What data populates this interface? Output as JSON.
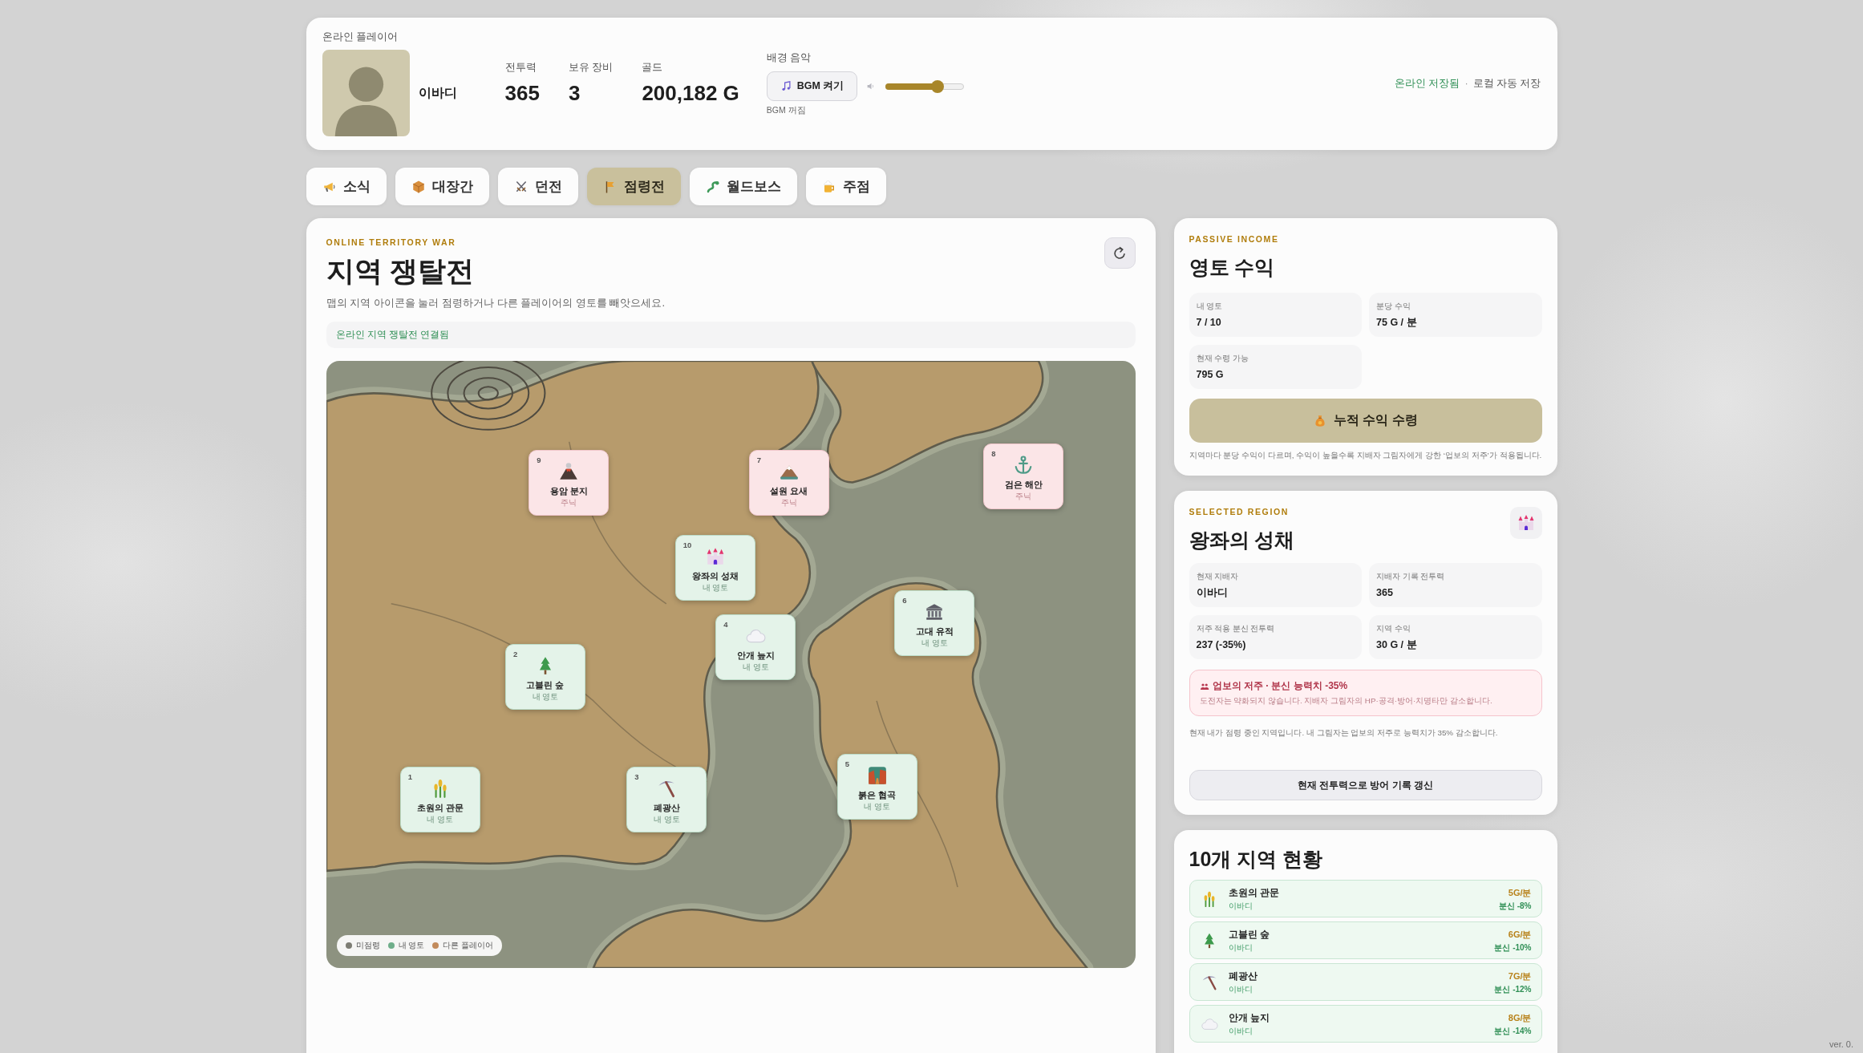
{
  "header": {
    "caption": "온라인 플레이어",
    "player": {
      "name": "이바디"
    },
    "stats": [
      {
        "label": "전투력",
        "value": "365"
      },
      {
        "label": "보유 장비",
        "value": "3"
      },
      {
        "label": "골드",
        "value": "200,182 G"
      }
    ],
    "bgm": {
      "label": "배경 음악",
      "button": "BGM 켜기",
      "status": "BGM 꺼짐",
      "volume": {
        "level": 0.66
      }
    },
    "save_status": {
      "online": "온라인 저장됨",
      "separator": "·",
      "local": "로컬 자동 저장"
    }
  },
  "tabs": [
    {
      "label": "소식",
      "selected": false
    },
    {
      "label": "대장간",
      "selected": false
    },
    {
      "label": "던전",
      "selected": false
    },
    {
      "label": "점령전",
      "selected": true
    },
    {
      "label": "월드보스",
      "selected": false
    },
    {
      "label": "주점",
      "selected": false
    }
  ],
  "territory_war": {
    "eyebrow": "ONLINE TERRITORY WAR",
    "title": "지역 쟁탈전",
    "description": "맵의 지역 아이콘을 눌러 점령하거나 다른 플레이어의 영토를 빼앗으세요.",
    "connection": "온라인 지역 쟁탈전 연결됨",
    "map": {
      "regions": [
        {
          "number": "1",
          "name": "초원의 관문",
          "owner": "내 영토",
          "mine": true
        },
        {
          "number": "2",
          "name": "고블린 숲",
          "owner": "내 영토",
          "mine": true
        },
        {
          "number": "3",
          "name": "폐광산",
          "owner": "내 영토",
          "mine": true
        },
        {
          "number": "4",
          "name": "안개 늪지",
          "owner": "내 영토",
          "mine": true
        },
        {
          "number": "5",
          "name": "붉은 협곡",
          "owner": "내 영토",
          "mine": true
        },
        {
          "number": "6",
          "name": "고대 유적",
          "owner": "내 영토",
          "mine": true
        },
        {
          "number": "7",
          "name": "설원 요새",
          "owner": "주닉",
          "mine": false
        },
        {
          "number": "8",
          "name": "검은 해안",
          "owner": "주닉",
          "mine": false
        },
        {
          "number": "9",
          "name": "용암 분지",
          "owner": "주닉",
          "mine": false
        },
        {
          "number": "10",
          "name": "왕좌의 성채",
          "owner": "내 영토",
          "mine": true
        }
      ],
      "legend": [
        {
          "label": "미점령",
          "color": "#7d7d74"
        },
        {
          "label": "내 영토",
          "color": "#6fae8a"
        },
        {
          "label": "다른 플레이어",
          "color": "#c28b5c"
        }
      ]
    }
  },
  "income": {
    "eyebrow": "PASSIVE INCOME",
    "title": "영토 수익",
    "stats": [
      {
        "label": "내 영토",
        "value": "7 / 10"
      },
      {
        "label": "분당 수익",
        "value": "75 G / 분"
      },
      {
        "label": "현재 수령 가능",
        "value": "795 G"
      }
    ],
    "claim_button": "누적 수익 수령",
    "note": "지역마다 분당 수익이 다르며, 수익이 높을수록 지배자 그림자에게 강한 ‘업보의 저주’가 적용됩니다."
  },
  "selected_region": {
    "eyebrow": "SELECTED REGION",
    "title": "왕좌의 성채",
    "stats": [
      {
        "label": "현재 지배자",
        "value": "이바디"
      },
      {
        "label": "지배자 기록 전투력",
        "value": "365"
      },
      {
        "label": "저주 적용 분신 전투력",
        "value": "237 (-35%)"
      },
      {
        "label": "지역 수익",
        "value": "30 G / 분"
      }
    ],
    "curse": {
      "title": "업보의 저주 · 분신 능력치 -35%",
      "detail": "도전자는 약화되지 않습니다. 지배자 그림자의 HP·공격·방어·치명타만 감소합니다."
    },
    "note": "현재 내가 점령 중인 지역입니다. 내 그림자는 업보의 저주로 능력치가 35% 감소합니다.",
    "update_button": "현재 전투력으로 방어 기록 갱신"
  },
  "region_status": {
    "title": "10개 지역 현황",
    "items": [
      {
        "name": "초원의 관문",
        "owner": "이바디",
        "income": "5G/분",
        "clone_penalty": "분신 -8%",
        "mine": true
      },
      {
        "name": "고블린 숲",
        "owner": "이바디",
        "income": "6G/분",
        "clone_penalty": "분신 -10%",
        "mine": true
      },
      {
        "name": "폐광산",
        "owner": "이바디",
        "income": "7G/분",
        "clone_penalty": "분신 -12%",
        "mine": true
      },
      {
        "name": "안개 늪지",
        "owner": "이바디",
        "income": "8G/분",
        "clone_penalty": "분신 -14%",
        "mine": true
      }
    ]
  },
  "version": "ver. 0."
}
